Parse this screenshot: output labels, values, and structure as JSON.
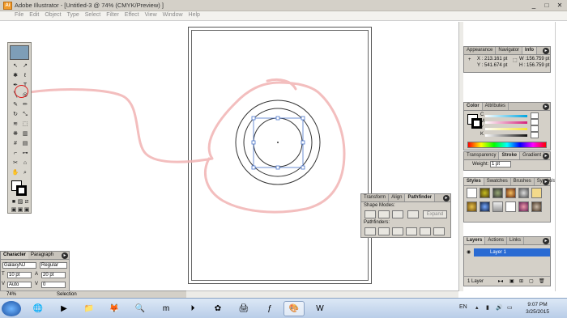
{
  "window": {
    "title": "Adobe Illustrator - [Untitled-3 @ 74% (CMYK/Preview) ]",
    "app_icon": "Ai",
    "buttons": [
      "_",
      "□",
      "✕"
    ]
  },
  "menubar": {
    "items": [
      "File",
      "Edit",
      "Object",
      "Type",
      "Select",
      "Filter",
      "Effect",
      "View",
      "Window",
      "Help"
    ]
  },
  "info_panel": {
    "tabs": [
      "Appearance",
      "Navigator",
      "Info"
    ],
    "x_label": "X :",
    "x_value": "213.161 pt",
    "y_label": "Y :",
    "y_value": "541.674 pt",
    "w_label": "W :",
    "w_value": "156.759 pt",
    "h_label": "H :",
    "h_value": "156.759 pt"
  },
  "color_panel": {
    "tabs": [
      "Color",
      "Attributes"
    ],
    "channels": [
      "C",
      "M",
      "Y",
      "K"
    ],
    "colors": {
      "cyan": "#00a5e0",
      "magenta": "#d6217c",
      "yellow": "#f5e33a",
      "black": "#111111"
    }
  },
  "stroke_panel": {
    "tabs": [
      "Transparency",
      "Stroke",
      "Gradient"
    ],
    "weight_label": "Weight:",
    "weight_value": "1 pt"
  },
  "styles_panel": {
    "tabs": [
      "Styles",
      "Swatches",
      "Brushes",
      "Symbols"
    ]
  },
  "pathfinder_panel": {
    "tabs": [
      "Transform",
      "Align",
      "Pathfinder"
    ],
    "shape_modes_label": "Shape Modes:",
    "expand_label": "Expand",
    "pathfinders_label": "Pathfinders:"
  },
  "layers_panel": {
    "tabs": [
      "Layers",
      "Actions",
      "Links"
    ],
    "layer_name": "Layer 1",
    "count_label": "1 Layer"
  },
  "character_panel": {
    "tabs": [
      "Character",
      "Paragraph"
    ],
    "font": "GalaxyNJ",
    "style": "Regular",
    "size": "10 pt",
    "leading": "20 pt",
    "kerning": "Auto",
    "tracking": "0"
  },
  "statusbar": {
    "zoom": "74%",
    "tool": "Selection"
  },
  "taskbar": {
    "language": "EN",
    "time": "9:07 PM",
    "date": "3/25/2015"
  }
}
